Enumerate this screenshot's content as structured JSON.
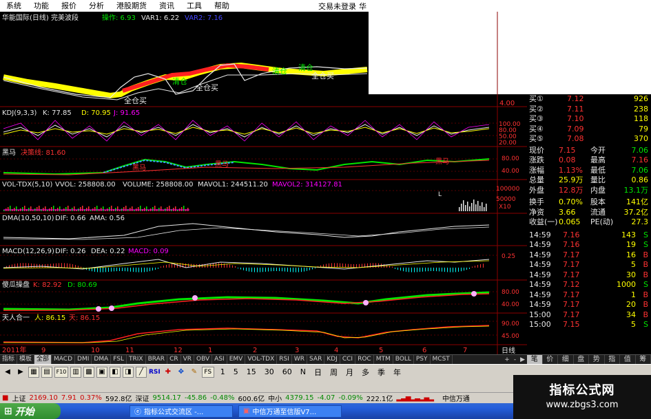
{
  "menu": {
    "items": [
      "系统",
      "功能",
      "报价",
      "分析",
      "港股期货",
      "资讯",
      "工具",
      "帮助"
    ],
    "login": "交易未登录",
    "extra": "华"
  },
  "panels": {
    "p1": {
      "title": "华能国际(日线) 完美波段",
      "l1": "操作: 6.93",
      "l2": "VAR1: 6.22",
      "l3": "VAR2: 7.16",
      "sig1": "全仓买",
      "sig2": "全仓买",
      "sig3": "清仓",
      "sig4": "清仓",
      "sig5": "全仓买",
      "sig6": "清仓",
      "price": "4.00"
    },
    "p2": {
      "title": "KDJ(9,3,3)",
      "k": "K: 77.85",
      "d": "D: 70.95",
      "j": "J: 91.65",
      "t1": "100.00",
      "t2": "80.00",
      "t3": "50.00",
      "t4": "20.00"
    },
    "p3": {
      "title": "黑马",
      "l1": "决策线: 81.60",
      "sig": "黑马",
      "t1": "80.00",
      "t2": "40.00"
    },
    "p4": {
      "title": "VOL-TDX(5,10)",
      "l1": "VVOL: 258808.00",
      "l2": "VOLUME: 258808.00",
      "l3": "MAVOL1: 244511.20",
      "l4": "MAVOL2: 314127.81",
      "t1": "100000",
      "t2": "50000",
      "unit": "X10"
    },
    "p5": {
      "title": "DMA(10,50,10)",
      "l1": "DIF: 0.66",
      "l2": "AMA: 0.56"
    },
    "p6": {
      "title": "MACD(12,26,9)",
      "l1": "DIF: 0.26",
      "l2": "DEA: 0.22",
      "l3": "MACD: 0.09",
      "t1": "0.25"
    },
    "p7": {
      "title": "傻瓜操盘",
      "l1": "K: 82.92",
      "l2": "D: 80.69",
      "t1": "80.00",
      "t2": "40.00"
    },
    "p8": {
      "title": "天人合一",
      "l1": "人: 86.15",
      "l2": "天: 86.15",
      "t1": "90.00",
      "t2": "45.00"
    }
  },
  "xaxis": {
    "labels": [
      "2011年",
      "9",
      "10",
      "11",
      "12",
      "1",
      "2",
      "3",
      "4",
      "5",
      "6",
      "7"
    ],
    "period": "日线"
  },
  "quote": {
    "bids": [
      {
        "label": "买①",
        "price": "7.12",
        "vol": "926"
      },
      {
        "label": "买②",
        "price": "7.11",
        "vol": "238"
      },
      {
        "label": "买③",
        "price": "7.10",
        "vol": "118"
      },
      {
        "label": "买④",
        "price": "7.09",
        "vol": "79"
      },
      {
        "label": "买⑤",
        "price": "7.08",
        "vol": "370"
      }
    ],
    "stats": [
      {
        "k1": "现价",
        "v1": "7.15",
        "k2": "今开",
        "v2": "7.06"
      },
      {
        "k1": "涨跌",
        "v1": "0.08",
        "k2": "最高",
        "v2": "7.16"
      },
      {
        "k1": "涨幅",
        "v1": "1.13%",
        "k2": "最低",
        "v2": "7.06"
      },
      {
        "k1": "总量",
        "v1": "25.9万",
        "k2": "量比",
        "v2": "0.86"
      },
      {
        "k1": "外盘",
        "v1": "12.8万",
        "k2": "内盘",
        "v2": "13.1万"
      }
    ],
    "fund": [
      {
        "k1": "换手",
        "v1": "0.70%",
        "k2": "股本",
        "v2": "141亿"
      },
      {
        "k1": "净资",
        "v1": "3.66",
        "k2": "流通",
        "v2": "37.2亿"
      },
      {
        "k1": "收益(一)",
        "v1": "0.065",
        "k2": "PE(动)",
        "v2": "27.3"
      }
    ],
    "ticks": [
      {
        "t": "14:59",
        "p": "7.16",
        "v": "143",
        "s": "S"
      },
      {
        "t": "14:59",
        "p": "7.16",
        "v": "19",
        "s": "S"
      },
      {
        "t": "14:59",
        "p": "7.17",
        "v": "16",
        "s": "B"
      },
      {
        "t": "14:59",
        "p": "7.17",
        "v": "5",
        "s": "B"
      },
      {
        "t": "14:59",
        "p": "7.17",
        "v": "30",
        "s": "B"
      },
      {
        "t": "14:59",
        "p": "7.12",
        "v": "1000",
        "s": "S"
      },
      {
        "t": "14:59",
        "p": "7.17",
        "v": "1",
        "s": "B"
      },
      {
        "t": "14:59",
        "p": "7.17",
        "v": "20",
        "s": "B"
      },
      {
        "t": "15:00",
        "p": "7.17",
        "v": "34",
        "s": "B"
      },
      {
        "t": "15:00",
        "p": "7.15",
        "v": "5",
        "s": "S"
      }
    ]
  },
  "tabs": [
    "指标",
    "模板",
    "全部",
    "MACD",
    "DMI",
    "DMA",
    "FSL",
    "TRIX",
    "BRAR",
    "CR",
    "VR",
    "OBV",
    "ASI",
    "EMV",
    "VOL-TDX",
    "RSI",
    "WR",
    "SAR",
    "KDJ",
    "CCI",
    "ROC",
    "MTM",
    "BOLL",
    "PSY",
    "MCST"
  ],
  "tab_nav": [
    "+",
    "-",
    "▶"
  ],
  "right_tabs": [
    "笔",
    "价",
    "细",
    "盘",
    "势",
    "指",
    "值",
    "筹"
  ],
  "toolbar": {
    "icons": [
      "back-icon",
      "forward-icon",
      "table-icon",
      "fdc-icon",
      "f10-icon",
      "layout-icon",
      "grid-icon",
      "window-icon",
      "f2-icon",
      "f1-icon",
      "line-icon",
      "rsi-icon",
      "bolt-icon",
      "move-icon",
      "pen-icon"
    ],
    "rsi": "RSI",
    "fs": "FS",
    "fdc": "F10",
    "periods": [
      "1",
      "5",
      "15",
      "30",
      "60",
      "N",
      "日",
      "周",
      "月",
      "多",
      "季",
      "年"
    ]
  },
  "status": {
    "sh_label": "上证",
    "sh_val": "2169.10",
    "sh_chg": "7.91",
    "sh_pct": "0.37%",
    "sh_amt": "592.8亿",
    "sz_label": "深证",
    "sz_val": "9514.17",
    "sz_chg": "-45.86",
    "sz_pct": "-0.48%",
    "sz_amt": "600.6亿",
    "zx_label": "中小",
    "zx_val": "4379.15",
    "zx_chg": "-4.07",
    "zx_pct": "-0.09%",
    "zx_amt": "222.1亿",
    "broker": "中信万通"
  },
  "taskbar": {
    "start": "开始",
    "t1": "指标公式交流区 -...",
    "t2": "中信万通至信版V7..."
  },
  "watermark": {
    "l1": "指标公式网",
    "l2": "www.zbgs3.com"
  },
  "colors": {
    "up": "#ff3232",
    "down": "#00e600",
    "bg": "#000000",
    "grid": "#8b0000"
  }
}
